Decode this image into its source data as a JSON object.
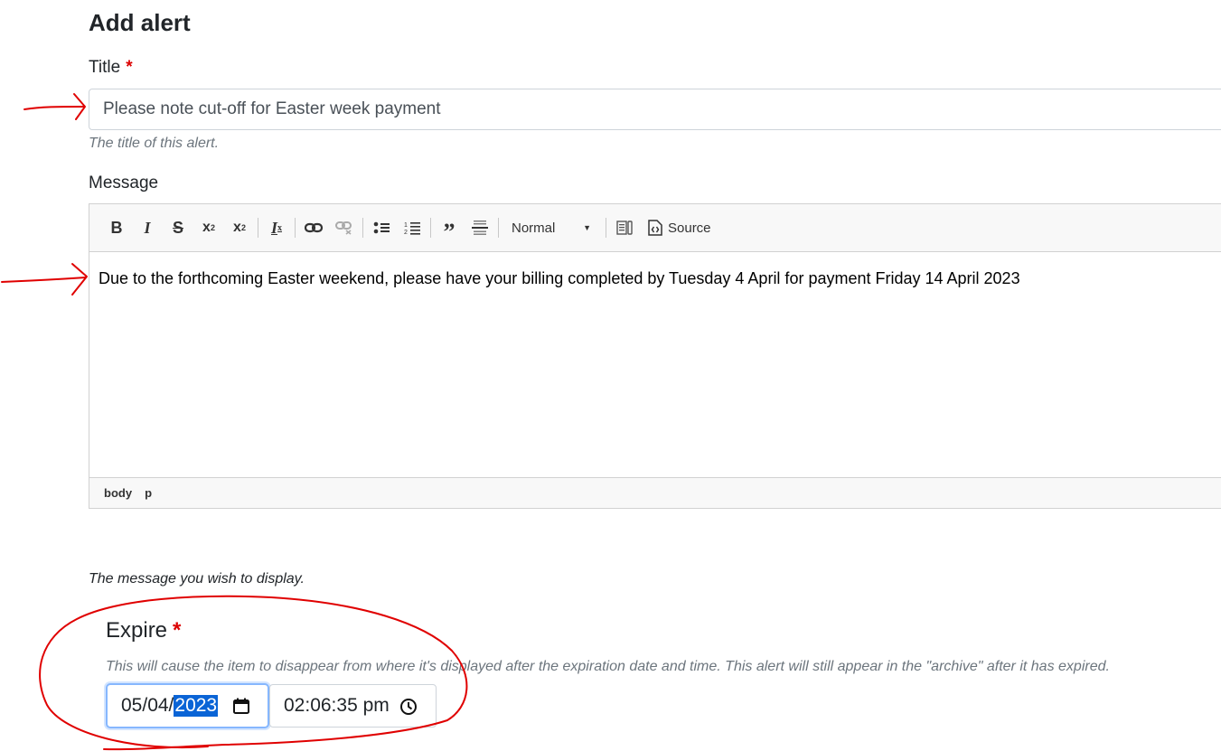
{
  "page": {
    "title": "Add alert"
  },
  "title_field": {
    "label": "Title",
    "required_mark": "*",
    "value": "Please note cut-off for Easter week payment",
    "help": "The title of this alert."
  },
  "message_field": {
    "label": "Message",
    "toolbar": {
      "buttons": [
        "bold-icon",
        "italic-icon",
        "strikethrough-icon",
        "superscript-icon",
        "subscript-icon",
        "remove-format-icon",
        "link-icon",
        "unlink-icon",
        "bulleted-list-icon",
        "numbered-list-icon",
        "blockquote-icon",
        "horizontal-line-icon",
        "show-blocks-icon",
        "source-icon"
      ],
      "format_value": "Normal",
      "source_label": "Source"
    },
    "content": "Due to the forthcoming Easter weekend, please have your billing completed by Tuesday 4 April for payment Friday 14 April 2023",
    "path": [
      "body",
      "p"
    ],
    "help": "The message you wish to display."
  },
  "expire_field": {
    "label": "Expire",
    "required_mark": "*",
    "help": "This will cause the item to disappear from where it's displayed after the expiration date and time. This alert will still appear in the \"archive\" after it has expired.",
    "date_day_month": "05/04/",
    "date_year": "2023",
    "time_value": "02:06:35 pm"
  },
  "colors": {
    "required": "#dc0000",
    "annotation": "#e00000",
    "selection": "#0a64d6"
  }
}
